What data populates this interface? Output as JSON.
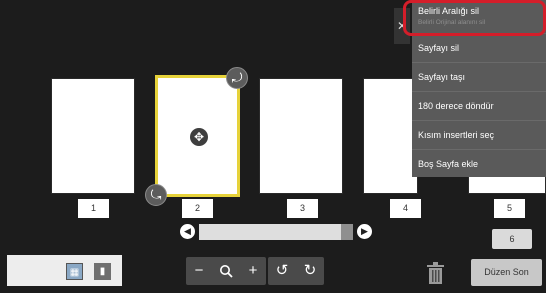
{
  "pages": {
    "numbers": [
      "1",
      "2",
      "3",
      "4",
      "5"
    ],
    "selected_index": 2,
    "total_label": "6"
  },
  "scrollbar": {
    "position_fraction": 0.92
  },
  "icons": {
    "move": "move-arrows-icon",
    "rotate_top": "rotate-handle-icon",
    "rotate_bottom": "rotate-handle-icon",
    "zoom_out": "minus-icon",
    "zoom": "magnifier-icon",
    "zoom_in": "plus-icon",
    "rotate_left": "rotate-left-icon",
    "rotate_right": "rotate-right-icon",
    "trash": "trash-icon",
    "close": "close-icon"
  },
  "toolbar": {
    "done_label": "Düzen Son"
  },
  "context_menu": {
    "items": [
      {
        "label": "Belirli Aralığı sil",
        "sublabel": "Belirli Orijinal alanını sil"
      },
      {
        "label": "Sayfayı sil"
      },
      {
        "label": "Sayfayı taşı"
      },
      {
        "label": "180 derece döndür"
      },
      {
        "label": "Kısım insertleri seç"
      },
      {
        "label": "Boş Sayfa ekle"
      }
    ],
    "highlighted_index": 0
  },
  "colors": {
    "background": "#1c1c1c",
    "selection": "#e6d23a",
    "menu": "#5a5a5a",
    "highlight": "#d41e2a"
  }
}
